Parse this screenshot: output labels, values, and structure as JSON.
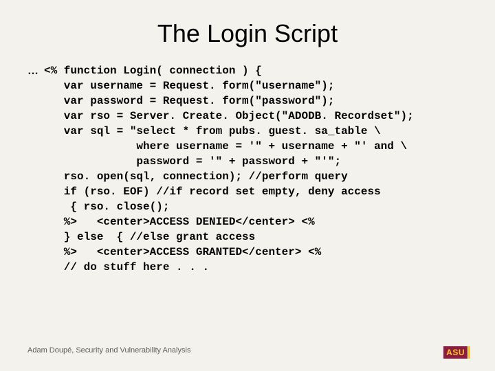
{
  "title": "The Login Script",
  "ellipsis": "…",
  "code_lines": [
    "<% function Login( connection ) {",
    "   var username = Request. form(\"username\");",
    "   var password = Request. form(\"password\");",
    "   var rso = Server. Create. Object(\"ADODB. Recordset\");",
    "   var sql = \"select * from pubs. guest. sa_table \\",
    "              where username = '\" + username + \"' and \\",
    "              password = '\" + password + \"'\";",
    "   rso. open(sql, connection); //perform query",
    "   if (rso. EOF) //if record set empty, deny access",
    "    { rso. close();",
    "   %>   <center>ACCESS DENIED</center> <%",
    "   } else  { //else grant access",
    "   %>   <center>ACCESS GRANTED</center> <%",
    "   // do stuff here . . ."
  ],
  "footer": "Adam Doupé, Security and Vulnerability Analysis",
  "logo": {
    "text": "ASU",
    "brand_maroon": "#8c1d40",
    "brand_gold": "#ffc627"
  }
}
